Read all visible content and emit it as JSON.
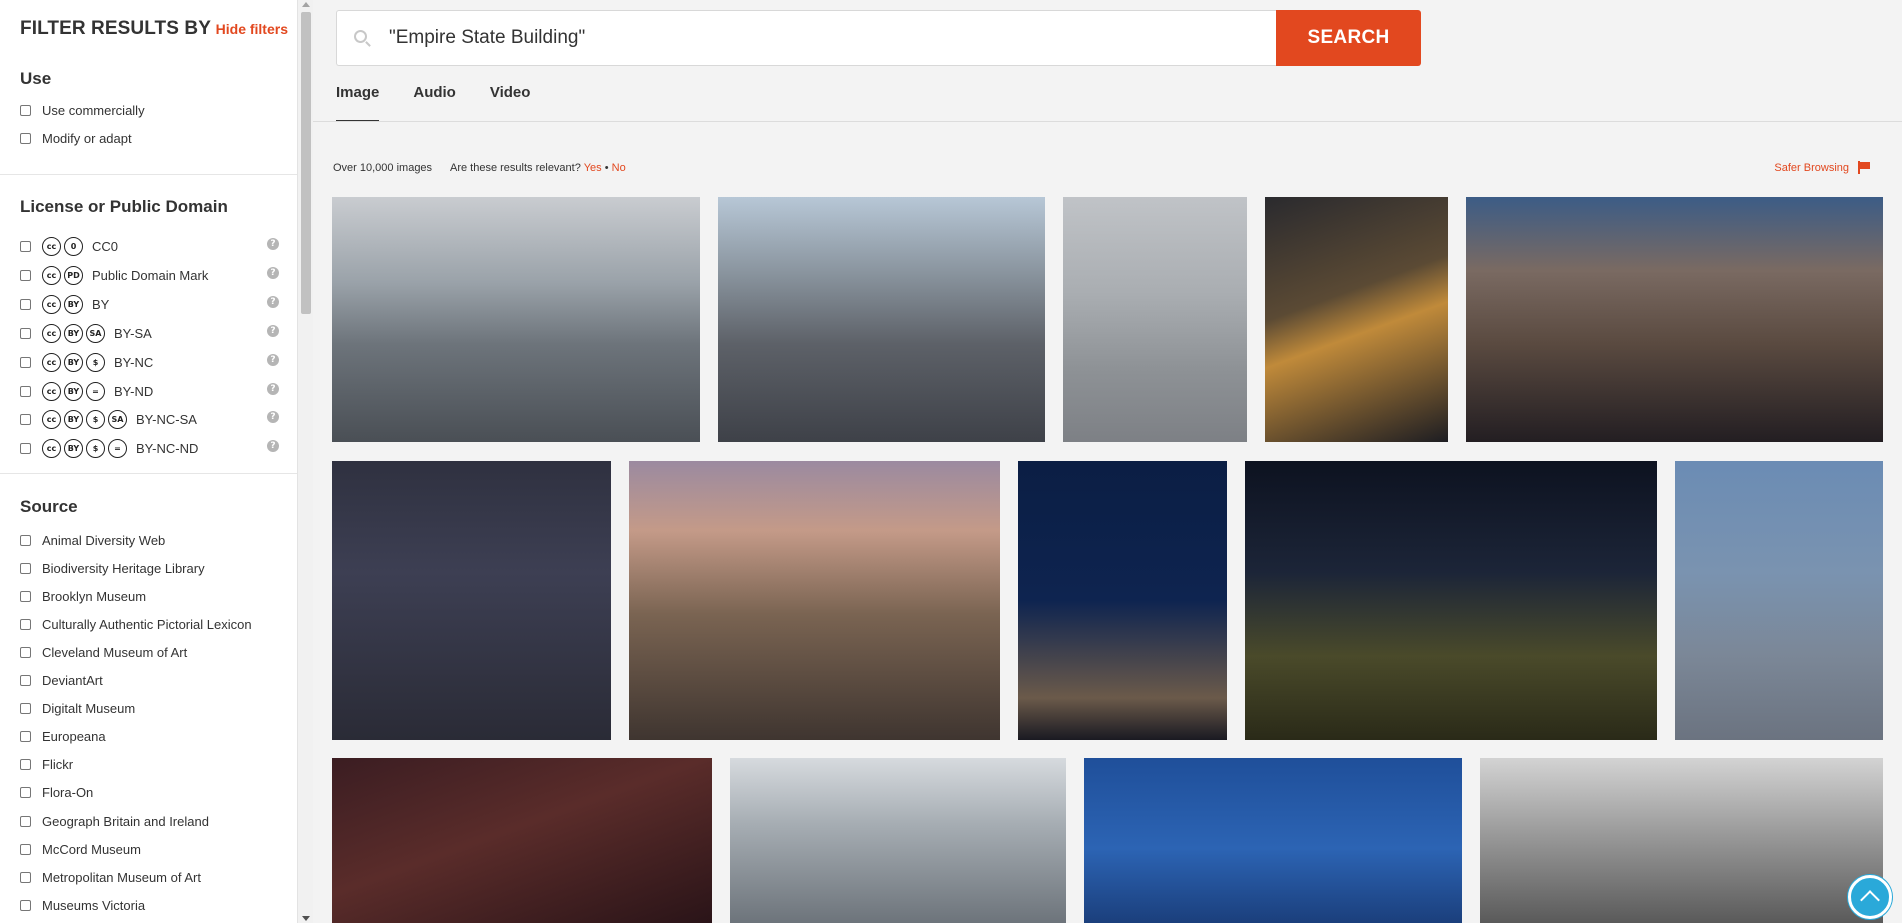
{
  "sidebar": {
    "title": "FILTER RESULTS BY",
    "hide_filters": "Hide filters",
    "use": {
      "title": "Use",
      "options": [
        "Use commercially",
        "Modify or adapt"
      ]
    },
    "license": {
      "title": "License or Public Domain",
      "options": [
        {
          "label": "CC0",
          "icons": [
            "cc-icon",
            "zero-icon"
          ]
        },
        {
          "label": "Public Domain Mark",
          "icons": [
            "cc-icon",
            "public-domain-icon"
          ]
        },
        {
          "label": "BY",
          "icons": [
            "cc-icon",
            "by-icon"
          ]
        },
        {
          "label": "BY-SA",
          "icons": [
            "cc-icon",
            "by-icon",
            "sa-icon"
          ]
        },
        {
          "label": "BY-NC",
          "icons": [
            "cc-icon",
            "by-icon",
            "nc-icon"
          ]
        },
        {
          "label": "BY-ND",
          "icons": [
            "cc-icon",
            "by-icon",
            "nd-icon"
          ]
        },
        {
          "label": "BY-NC-SA",
          "icons": [
            "cc-icon",
            "by-icon",
            "nc-icon",
            "sa-icon"
          ]
        },
        {
          "label": "BY-NC-ND",
          "icons": [
            "cc-icon",
            "by-icon",
            "nc-icon",
            "nd-icon"
          ]
        }
      ]
    },
    "source": {
      "title": "Source",
      "options": [
        "Animal Diversity Web",
        "Biodiversity Heritage Library",
        "Brooklyn Museum",
        "Culturally Authentic Pictorial Lexicon",
        "Cleveland Museum of Art",
        "DeviantArt",
        "Digitalt Museum",
        "Europeana",
        "Flickr",
        "Flora-On",
        "Geograph Britain and Ireland",
        "McCord Museum",
        "Metropolitan Museum of Art",
        "Museums Victoria"
      ]
    }
  },
  "search": {
    "query": "\"Empire State Building\"",
    "button_label": "SEARCH"
  },
  "tabs": [
    "Image",
    "Audio",
    "Video"
  ],
  "results": {
    "count": "Over 10,000 images",
    "relevance_question": "Are these results relevant?",
    "yes": "Yes",
    "separator": "•",
    "no": "No",
    "safer_browsing": "Safer Browsing"
  },
  "colors": {
    "accent": "#e2481f",
    "scroll_top": "#2aa9d9"
  }
}
